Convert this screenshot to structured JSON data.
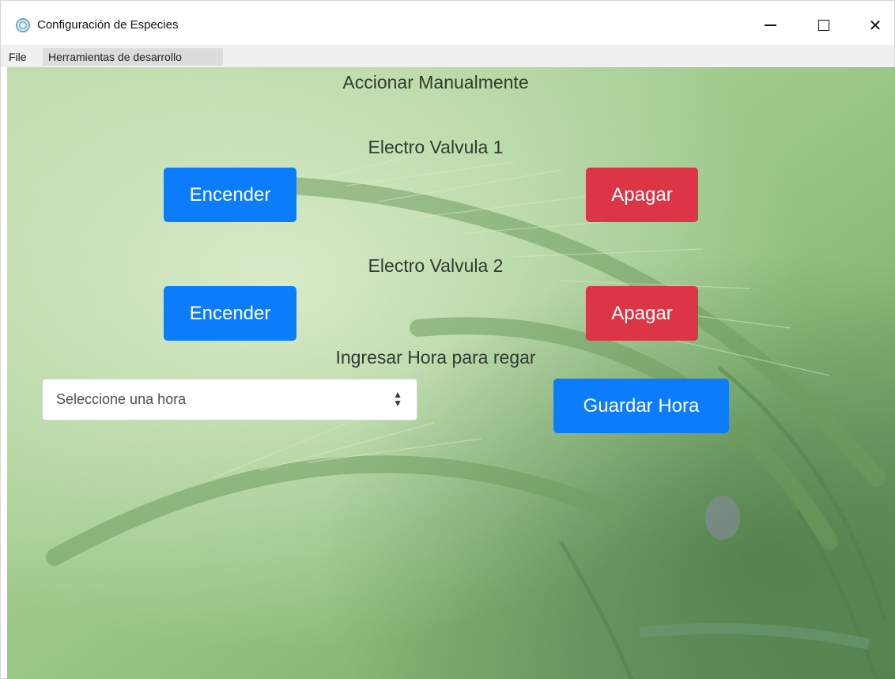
{
  "window": {
    "title": "Configuración de Especies",
    "app_icon": "electron-icon",
    "controls": {
      "minimize": "minimize-icon",
      "maximize": "maximize-icon",
      "close_label": "✕"
    }
  },
  "menu": {
    "items": [
      "File",
      "Herramientas de desarrollo"
    ]
  },
  "main": {
    "heading": "Accionar Manualmente",
    "valve1": {
      "title": "Electro Valvula 1",
      "on_label": "Encender",
      "off_label": "Apagar"
    },
    "valve2": {
      "title": "Electro Valvula 2",
      "on_label": "Encender",
      "off_label": "Apagar"
    },
    "schedule": {
      "title": "Ingresar Hora para regar",
      "select_value": "Seleccione una hora",
      "save_label": "Guardar Hora"
    }
  },
  "colors": {
    "primary": "#0b7dfb",
    "danger": "#dc3545",
    "menubar": "#f0f0f0"
  }
}
